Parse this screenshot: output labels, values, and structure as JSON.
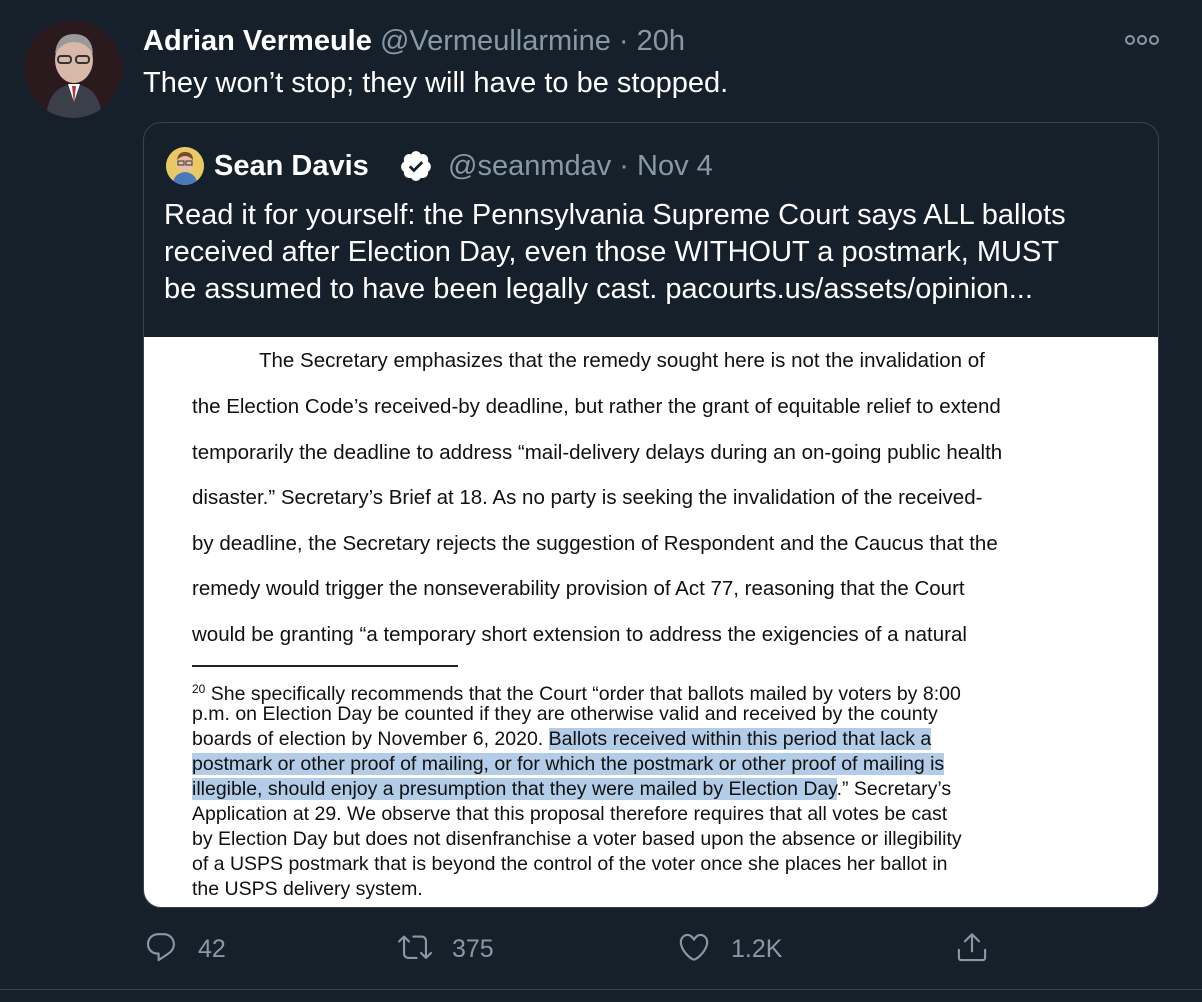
{
  "tweet": {
    "author_name": "Adrian Vermeule",
    "handle": "@Vermeullarmine",
    "separator": " · ",
    "time": "20h",
    "text": "They won’t stop; they will have to be stopped.",
    "more_icon": "more-horizontal-icon"
  },
  "quoted_tweet": {
    "author_name": "Sean Davis",
    "verified_icon": "verified-badge-icon",
    "handle": "@seanmdav",
    "separator": " · ",
    "date": "Nov 4",
    "text_lines": [
      "Read it for yourself: the Pennsylvania Supreme Court says ALL ballots",
      "received after Election Day, even those WITHOUT a postmark, MUST",
      "be assumed to have been legally cast. pacourts.us/assets/opinion..."
    ],
    "image": {
      "body_lines": [
        "The Secretary emphasizes that the remedy sought here is not the invalidation of",
        "the Election Code’s received-by deadline, but rather the grant of equitable relief to extend",
        "temporarily the deadline to address “mail-delivery delays during an on-going public health",
        "disaster.”  Secretary’s Brief at 18.  As no party is seeking the invalidation of the received-",
        "by deadline, the Secretary rejects the suggestion of Respondent and the Caucus that the",
        "remedy would trigger the nonseverability provision of Act 77, reasoning that the Court",
        "would be granting “a temporary short extension to address the exigencies of a natural"
      ],
      "footnote": {
        "number": "20",
        "line1": " She specifically recommends that the Court “order that ballots mailed by voters by 8:00",
        "line2": "p.m. on Election Day be counted if they are otherwise valid and received by the county",
        "line3_plain": "boards of election by November 6, 2020.  ",
        "line3_highlight": "Ballots received within this period that lack a",
        "line4_highlight": "postmark or other proof of mailing, or for which the postmark or other proof of mailing is",
        "line5_highlight": "illegible, should enjoy a presumption that they were mailed by Election Day",
        "line5_plain": ".”  Secretary’s",
        "line6": "Application at 29.  We observe that this proposal therefore requires that all votes be cast",
        "line7": "by Election Day but does not disenfranchise a voter based upon the absence or illegibility",
        "line8": "of a USPS postmark that is beyond the control of the voter once she places her ballot in",
        "line9": "the USPS delivery system."
      }
    }
  },
  "actions": {
    "reply_count": "42",
    "retweet_count": "375",
    "like_count": "1.2K",
    "icons": [
      "reply-icon",
      "retweet-icon",
      "like-icon",
      "share-icon"
    ]
  },
  "colors": {
    "background": "#15202b",
    "muted": "#8899a6",
    "border": "#38444d",
    "highlight": "#b3cde8"
  }
}
